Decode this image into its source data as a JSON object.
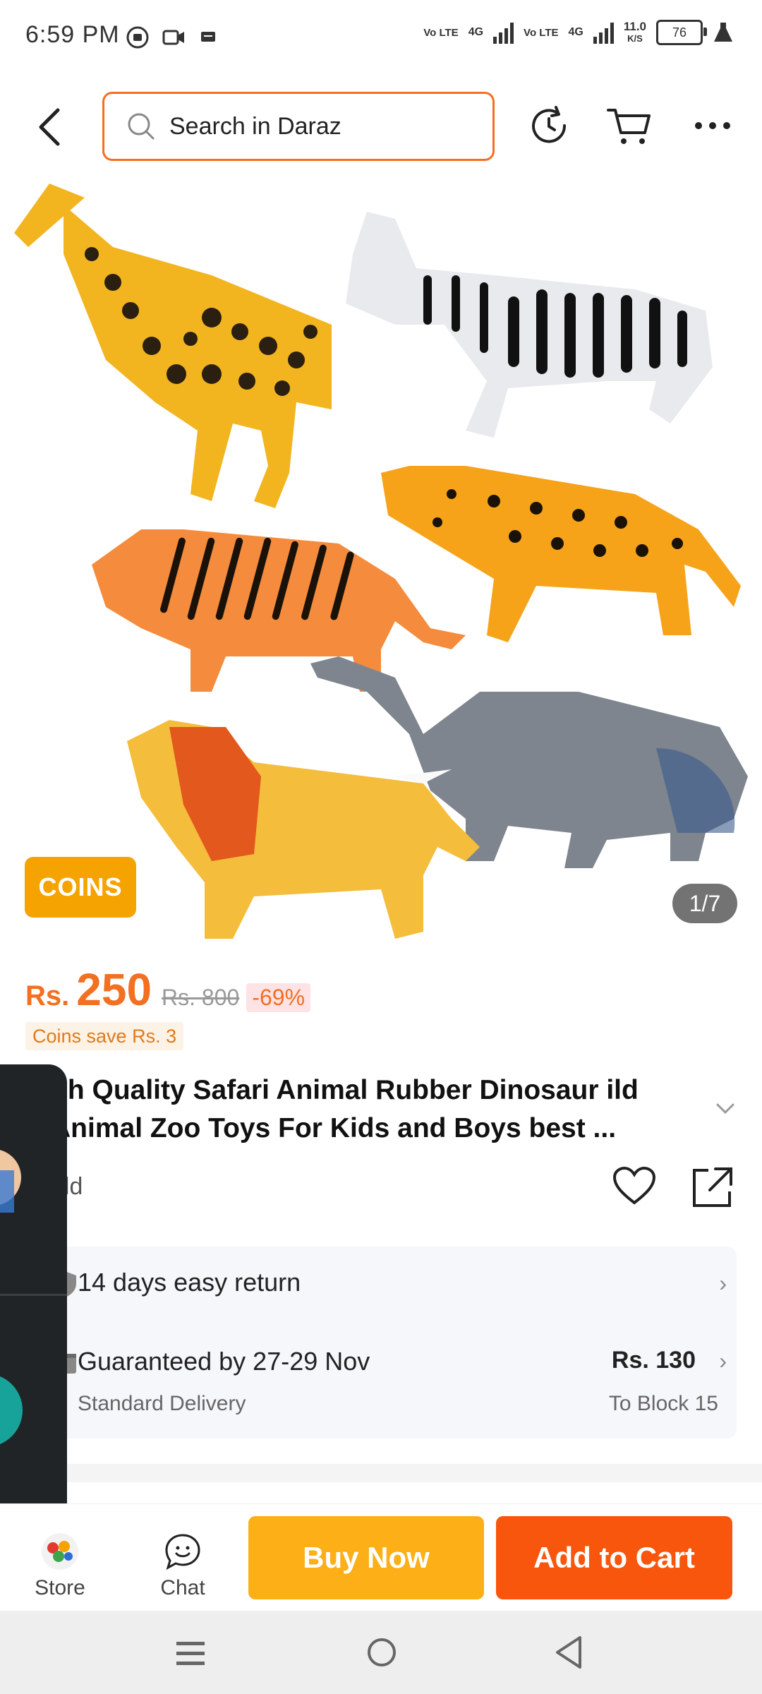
{
  "status_bar": {
    "time": "6:59 PM",
    "net1": "Vo LTE",
    "net_type1": "4G",
    "net2": "Vo LTE",
    "net_type2": "4G",
    "speed": "11.0",
    "speed_unit": "K/S",
    "battery": "76"
  },
  "topbar": {
    "search_placeholder": "Search in Daraz"
  },
  "gallery": {
    "coins_badge": "COINS",
    "page_indicator": "1/7"
  },
  "price": {
    "currency": "Rs.",
    "current": "250",
    "original": "Rs. 800",
    "discount": "-69%",
    "coins_save": "Coins save Rs. 3"
  },
  "product": {
    "title": "gh Quality Safari Animal Rubber Dinosaur ild Animal Zoo Toys For Kids and Boys best ...",
    "sold": "old"
  },
  "delivery": {
    "return_label": "14 days easy return",
    "guarantee_label": "Guaranteed by 27-29 Nov",
    "method": "Standard Delivery",
    "fee": "Rs. 130",
    "destination": "To Block 15"
  },
  "bottom_bar": {
    "store_label": "Store",
    "chat_label": "Chat",
    "buy_now": "Buy Now",
    "add_to_cart": "Add to Cart"
  },
  "colors": {
    "accent": "#f36f21",
    "buy_now": "#fcaf17",
    "add_to_cart": "#f8560d",
    "coins": "#f5a300"
  }
}
